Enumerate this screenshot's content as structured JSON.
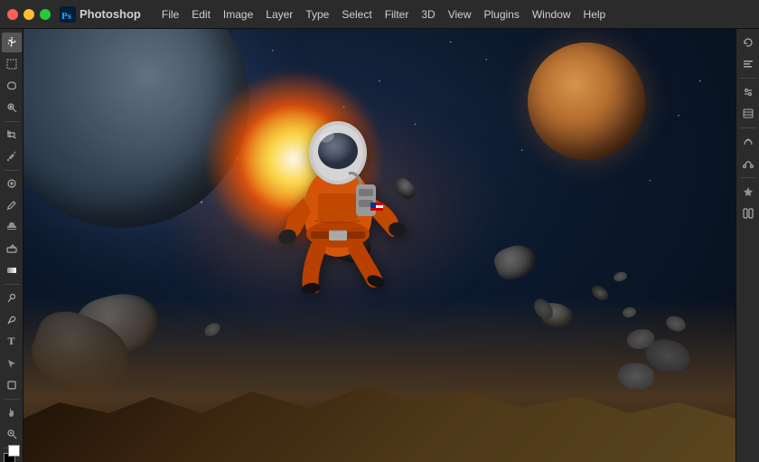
{
  "titlebar": {
    "app_name": "Photoshop",
    "traffic_lights": [
      "close",
      "minimize",
      "maximize"
    ],
    "menu_items": [
      "File",
      "Edit",
      "Image",
      "Layer",
      "Type",
      "Select",
      "Filter",
      "3D",
      "View",
      "Plugins",
      "Window",
      "Help"
    ]
  },
  "left_toolbar": {
    "tools": [
      {
        "name": "move",
        "icon": "✛",
        "label": "Move Tool"
      },
      {
        "name": "marquee",
        "icon": "⬚",
        "label": "Marquee Tool"
      },
      {
        "name": "lasso",
        "icon": "⌾",
        "label": "Lasso Tool"
      },
      {
        "name": "quick-select",
        "icon": "⚬",
        "label": "Quick Select"
      },
      {
        "name": "crop",
        "icon": "⊡",
        "label": "Crop Tool"
      },
      {
        "name": "eyedropper",
        "icon": "✏",
        "label": "Eyedropper"
      },
      {
        "name": "healing",
        "icon": "⊕",
        "label": "Healing Brush"
      },
      {
        "name": "brush",
        "icon": "✦",
        "label": "Brush Tool"
      },
      {
        "name": "stamp",
        "icon": "⊞",
        "label": "Clone Stamp"
      },
      {
        "name": "eraser",
        "icon": "◻",
        "label": "Eraser"
      },
      {
        "name": "gradient",
        "icon": "▣",
        "label": "Gradient"
      },
      {
        "name": "dodge",
        "icon": "◑",
        "label": "Dodge Tool"
      },
      {
        "name": "pen",
        "icon": "✒",
        "label": "Pen Tool"
      },
      {
        "name": "text",
        "icon": "T",
        "label": "Type Tool"
      },
      {
        "name": "path-select",
        "icon": "↖",
        "label": "Path Selection"
      },
      {
        "name": "shape",
        "icon": "□",
        "label": "Shape Tool"
      },
      {
        "name": "hand",
        "icon": "✋",
        "label": "Hand Tool"
      },
      {
        "name": "zoom",
        "icon": "🔍",
        "label": "Zoom Tool"
      }
    ]
  },
  "right_toolbar": {
    "tools": [
      {
        "name": "history",
        "icon": "↩"
      },
      {
        "name": "properties",
        "icon": "≡"
      },
      {
        "name": "adjustments",
        "icon": "◈"
      },
      {
        "name": "layers",
        "icon": "⧉"
      },
      {
        "name": "channels",
        "icon": "≋"
      },
      {
        "name": "paths",
        "icon": "⌇"
      },
      {
        "name": "effects",
        "icon": "✦"
      },
      {
        "name": "more",
        "icon": "⋯"
      }
    ]
  },
  "canvas": {
    "scene": "astronaut in space",
    "description": "Orange-suited astronaut floating in space with planets and asteroids"
  }
}
